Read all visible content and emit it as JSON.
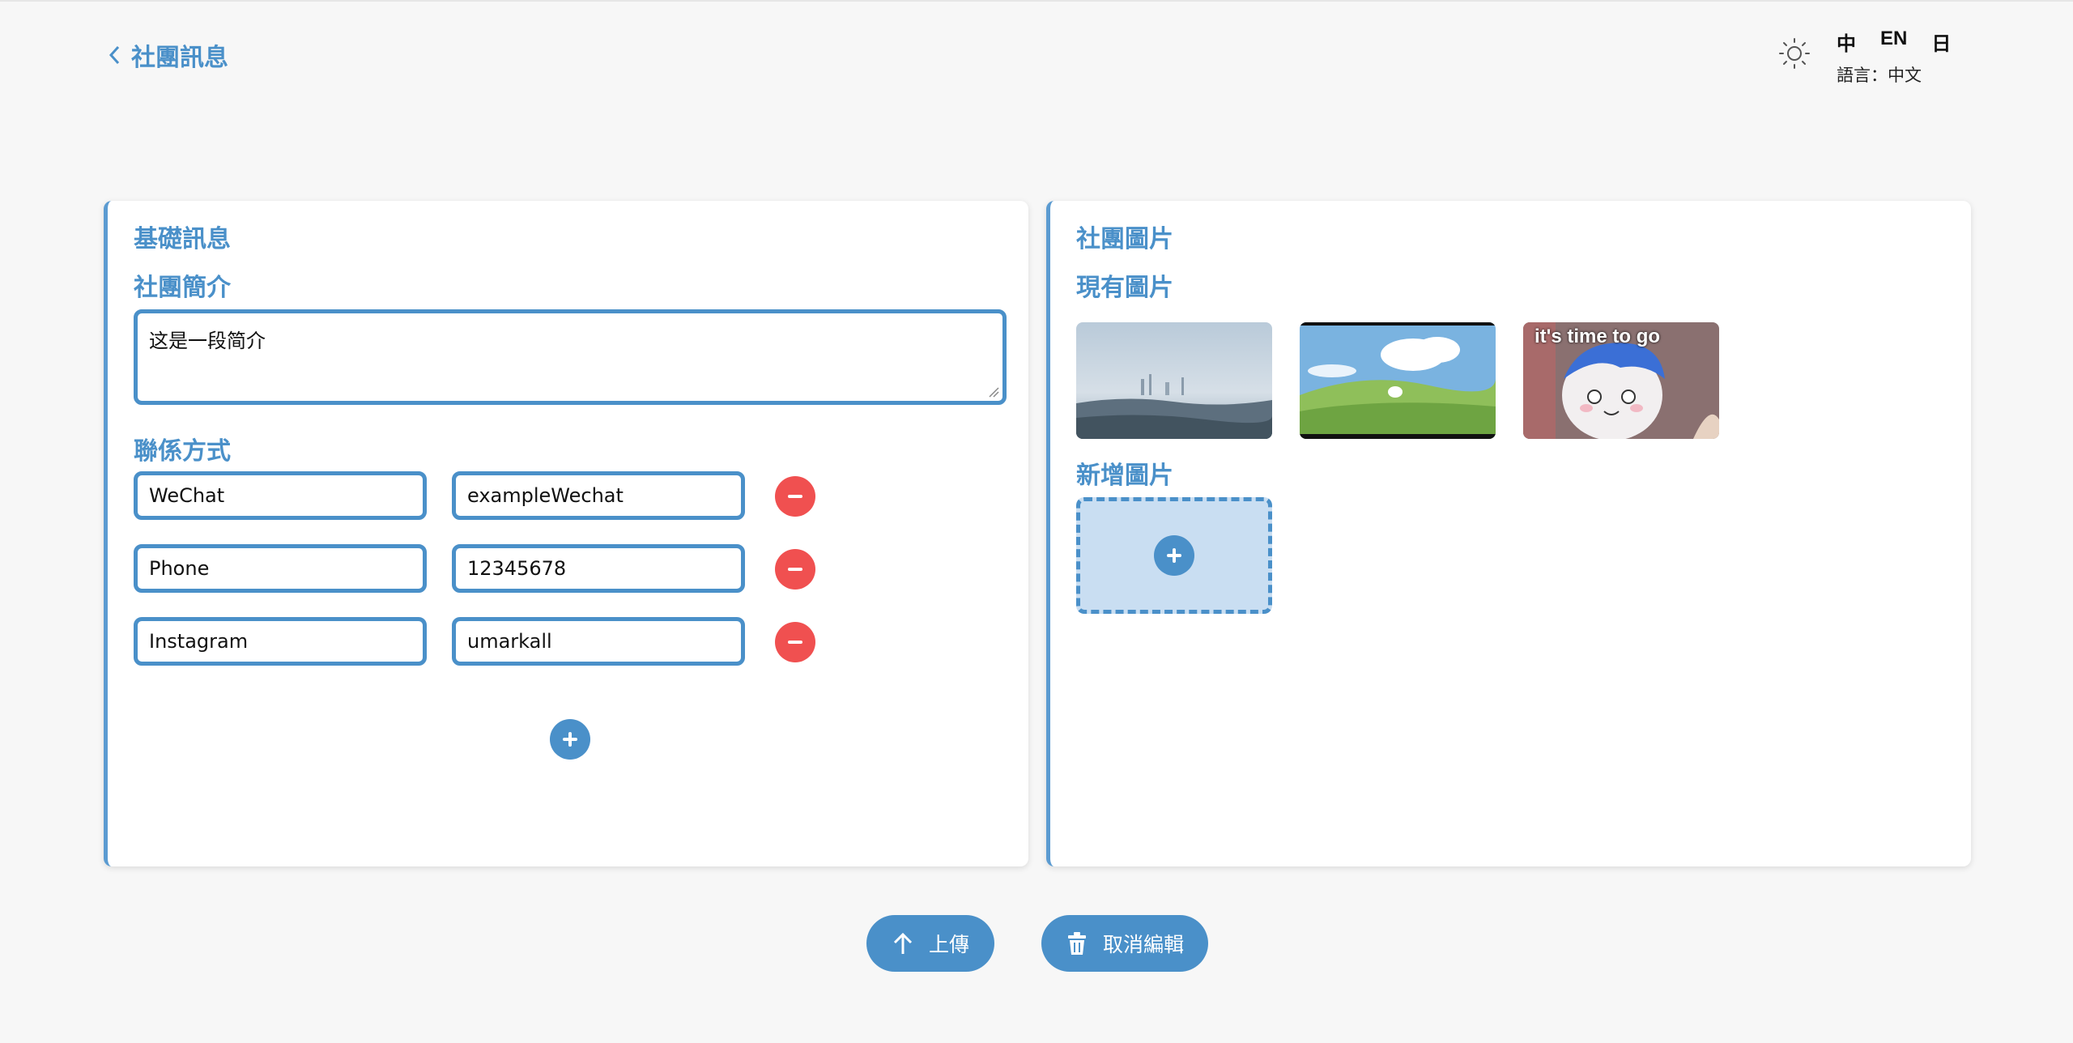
{
  "header": {
    "back_label": "社團訊息",
    "languages": [
      "中",
      "EN",
      "日"
    ],
    "current_language": "語言：中文"
  },
  "basic": {
    "title": "基礎訊息",
    "intro_title": "社團簡介",
    "intro_value": "这是一段简介",
    "contact_title": "聯係方式",
    "contacts": [
      {
        "type": "WeChat",
        "value": "exampleWechat"
      },
      {
        "type": "Phone",
        "value": "12345678"
      },
      {
        "type": "Instagram",
        "value": "umarkall"
      }
    ]
  },
  "images": {
    "title": "社團圖片",
    "existing_title": "現有圖片",
    "new_title": "新增圖片",
    "thumb3_caption": "it's time to go"
  },
  "actions": {
    "upload_label": "上傳",
    "cancel_label": "取消編輯"
  },
  "colors": {
    "accent": "#4a90c9",
    "danger": "#f05050",
    "background": "#f7f7f7"
  }
}
